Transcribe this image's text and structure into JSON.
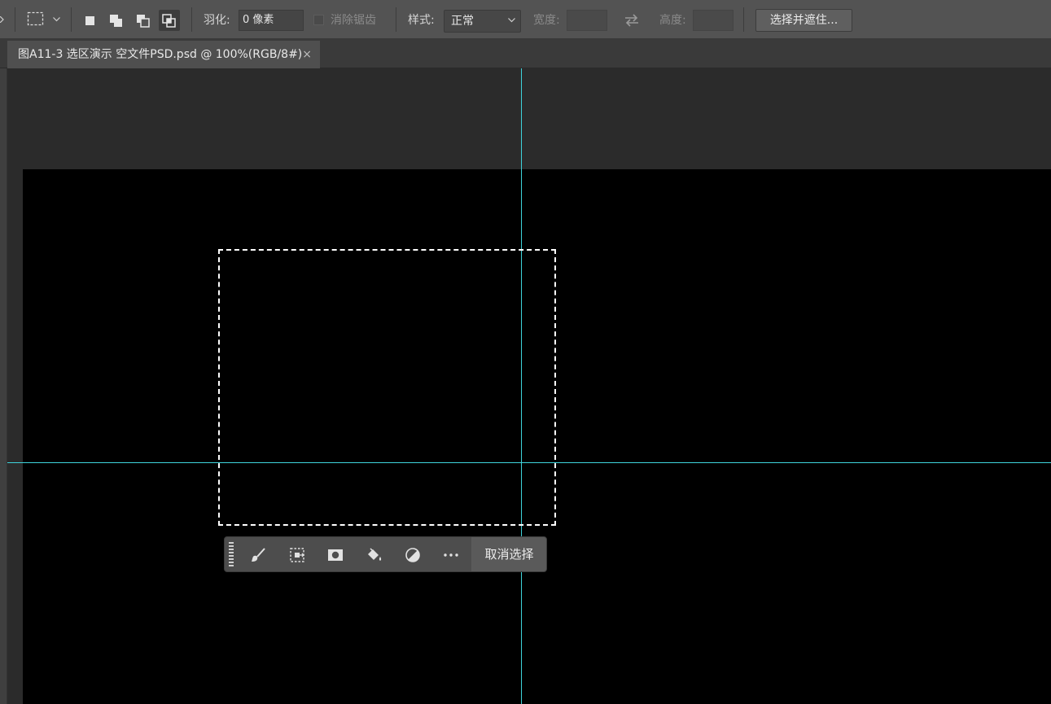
{
  "options_bar": {
    "tool_icon": "rectangular-marquee-icon",
    "selection_modes": [
      "new-selection-icon",
      "add-to-selection-icon",
      "subtract-from-selection-icon",
      "intersect-selection-icon"
    ],
    "feather_label": "羽化:",
    "feather_value": "0 像素",
    "anti_alias_label": "消除锯齿",
    "style_label": "样式:",
    "style_value": "正常",
    "width_label": "宽度:",
    "height_label": "高度:",
    "swap_icon": "swap-arrows-icon",
    "select_and_mask_label": "选择并遮住..."
  },
  "document_tab": {
    "title": "图A11-3 选区演示 空文件PSD.psd @ 100%(RGB/8#)",
    "close_glyph": "×"
  },
  "task_bar": {
    "icons": [
      "grip-handle-icon",
      "brush-icon",
      "transform-selection-icon",
      "mask-icon",
      "fill-bucket-icon",
      "adjustment-circle-icon",
      "more-options-icon"
    ],
    "deselect_label": "取消选择"
  },
  "colors": {
    "guide": "#3fd4dc",
    "canvas": "#000000",
    "ui_panel": "#535353"
  }
}
